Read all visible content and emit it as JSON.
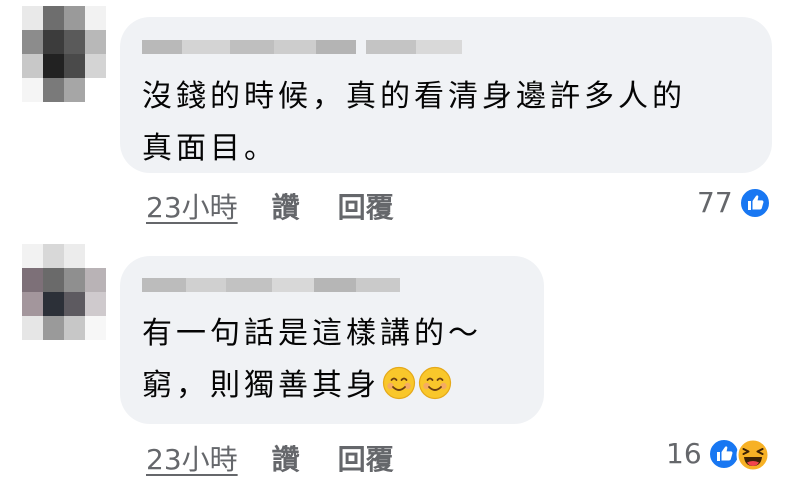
{
  "comments": [
    {
      "text_lines": [
        "沒錢的時候，真的看清身邊許多人的",
        "真面目。"
      ],
      "time": "23小時",
      "like_label": "讚",
      "reply_label": "回覆",
      "reaction_count": "77",
      "reactions": [
        "like-icon"
      ]
    },
    {
      "text_lines": [
        "有一句話是這樣講的～",
        "窮，則獨善其身"
      ],
      "emojis": [
        "smiling-face-emoji",
        "smiling-face-emoji"
      ],
      "time": "23小時",
      "like_label": "讚",
      "reply_label": "回覆",
      "reaction_count": "16",
      "reactions": [
        "like-icon",
        "haha-icon"
      ]
    }
  ],
  "colors": {
    "bubble": "#f0f2f5",
    "meta_text": "#65676b",
    "like_blue": "#1877f2",
    "haha_yellow": "#f7b125"
  }
}
